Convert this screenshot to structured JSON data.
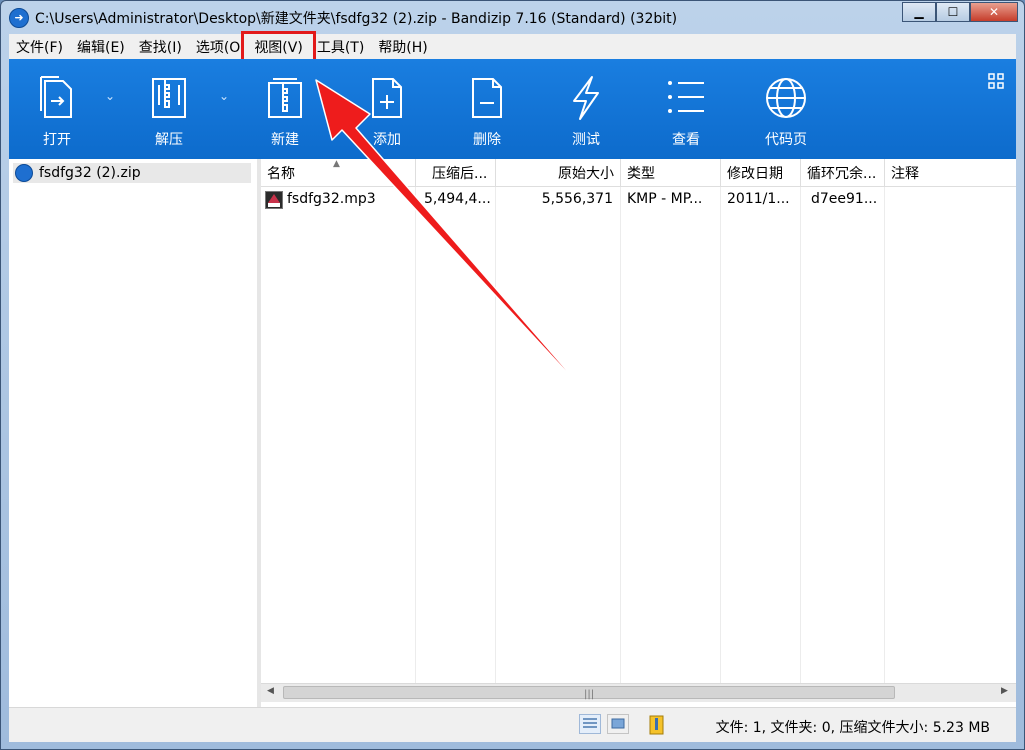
{
  "window": {
    "title": "C:\\Users\\Administrator\\Desktop\\新建文件夹\\fsdfg32 (2).zip - Bandizip 7.16 (Standard) (32bit)",
    "controls": {
      "minimize": "▁",
      "maximize": "☐",
      "close": "✕"
    }
  },
  "menu": {
    "items": [
      "文件(F)",
      "编辑(E)",
      "查找(I)",
      "选项(O",
      "视图(V)",
      "工具(T)",
      "帮助(H)"
    ],
    "highlighted": "视图(V)"
  },
  "toolbar": {
    "buttons": [
      {
        "label": "打开",
        "icon": "open-file-icon"
      },
      {
        "label": "解压",
        "icon": "extract-zip-icon"
      },
      {
        "label": "新建",
        "icon": "new-zip-icon"
      },
      {
        "label": "添加",
        "icon": "add-file-icon"
      },
      {
        "label": "删除",
        "icon": "delete-file-icon"
      },
      {
        "label": "测试",
        "icon": "test-lightning-icon"
      },
      {
        "label": "查看",
        "icon": "view-list-icon"
      },
      {
        "label": "代码页",
        "icon": "globe-icon"
      }
    ],
    "dropdown_glyph": "⌄"
  },
  "tree": {
    "items": [
      {
        "label": "fsdfg32 (2).zip"
      }
    ]
  },
  "file_list": {
    "columns": [
      "名称",
      "压缩后...",
      "原始大小",
      "类型",
      "修改日期",
      "循环冗余...",
      "注释"
    ],
    "sort_glyph": "▲",
    "rows": [
      {
        "name": "fsdfg32.mp3",
        "packed": "5,494,4...",
        "size": "5,556,371",
        "type": "KMP - MP...",
        "modified": "2011/1...",
        "crc": "d7ee91...",
        "comment": ""
      }
    ]
  },
  "status": {
    "text": "文件: 1, 文件夹: 0, 压缩文件大小: 5.23 MB"
  },
  "colors": {
    "toolbar": "#1478da",
    "highlight": "#e21a1a",
    "arrow": "#ee1c1c"
  }
}
